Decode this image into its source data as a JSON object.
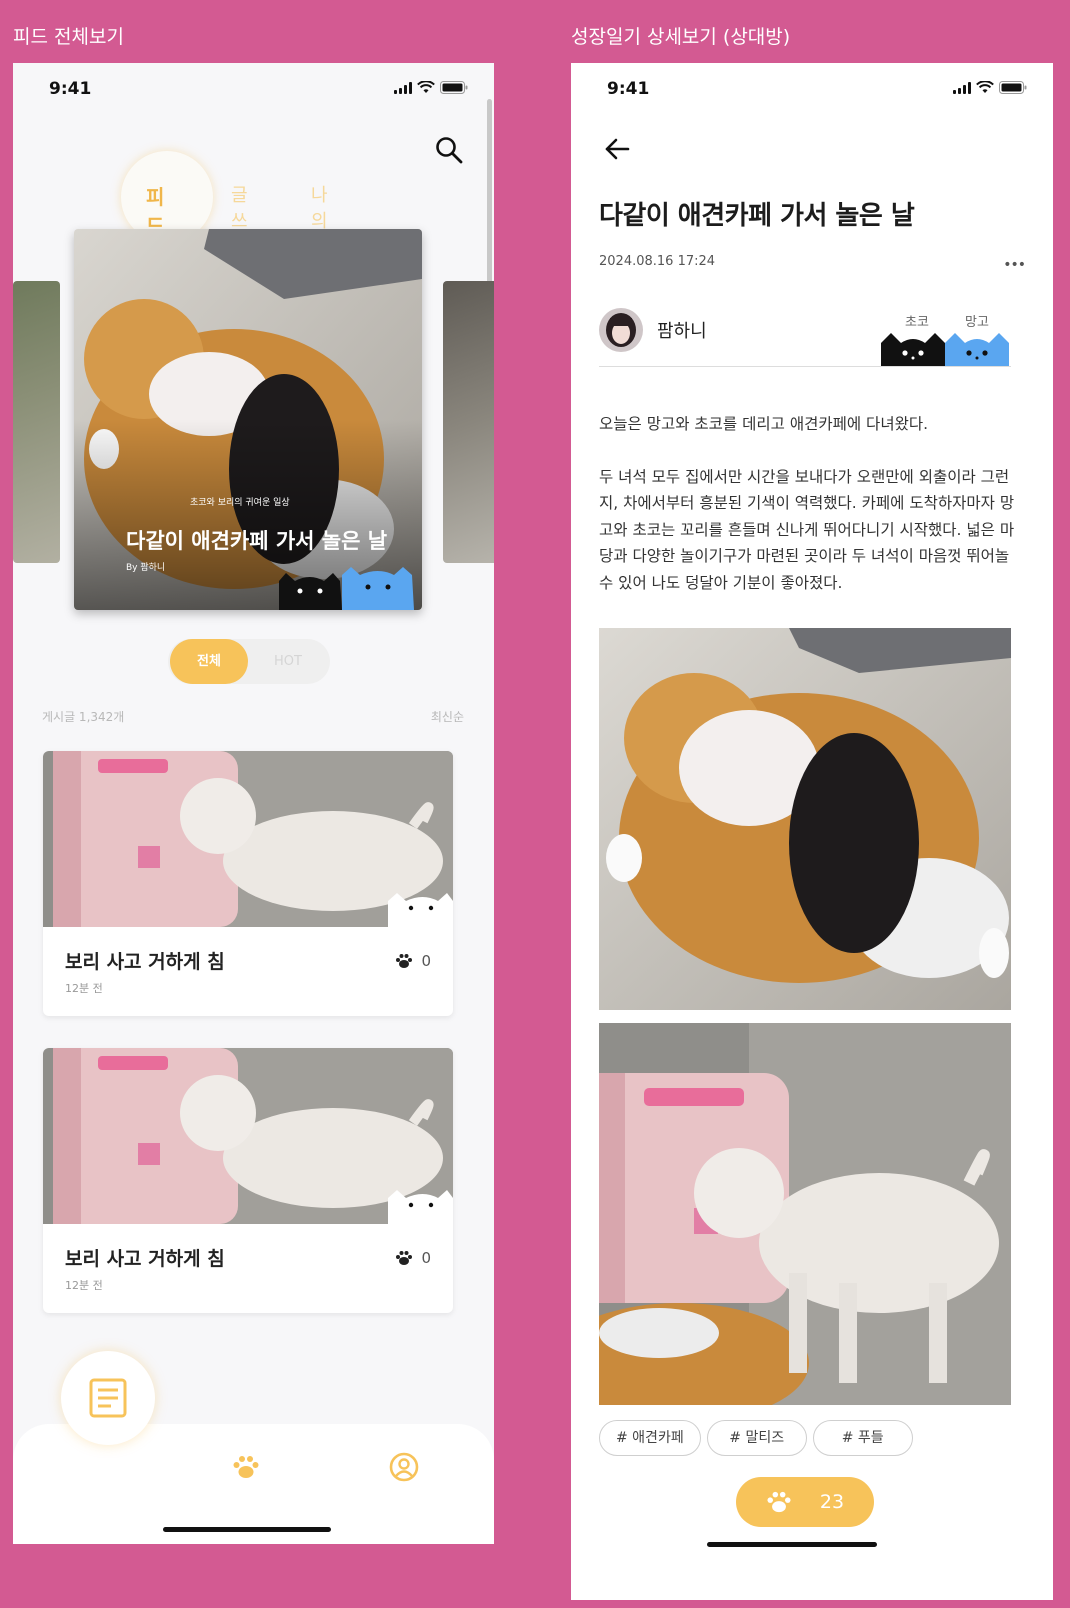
{
  "labels": {
    "left_frame": "피드 전체보기",
    "right_frame": "성장일기 상세보기 (상대방)"
  },
  "status": {
    "time": "9:41"
  },
  "feed": {
    "tabs": [
      "피드",
      "글쓰기",
      "나의 글"
    ],
    "hero": {
      "subtitle": "초코와 보리의 귀여운 일상",
      "title": "다같이 애견카페 가서 놀은 날",
      "by": "By 팜하니"
    },
    "segment": {
      "all": "전체",
      "hot": "HOT"
    },
    "post_count": "게시글 1,342개",
    "sort": "최신순",
    "posts": [
      {
        "title": "보리 사고 거하게 침",
        "time": "12분 전",
        "likes": "0"
      },
      {
        "title": "보리 사고 거하게 침",
        "time": "12분 전",
        "likes": "0"
      }
    ]
  },
  "detail": {
    "title": "다같이 애견카페 가서 놀은 날",
    "date": "2024.08.16 17:24",
    "more": "•••",
    "author": "팜하니",
    "pets": [
      "초코",
      "망고"
    ],
    "body": [
      "오늘은 망고와 초코를 데리고 애견카페에 다녀왔다.",
      "두 녀석 모두 집에서만 시간을 보내다가 오랜만에 외출이라 그런지, 차에서부터 흥분된 기색이 역력했다. 카페에 도착하자마자 망고와 초코는 꼬리를 흔들며 신나게 뛰어다니기 시작했다. 넓은 마당과 다양한 놀이기구가 마련된 곳이라 두 녀석이 마음껏 뛰어놀 수 있어 나도 덩달아 기분이 좋아졌다."
    ],
    "tags": [
      "# 애견카페",
      "# 말티즈",
      "# 푸들"
    ],
    "likes": "23"
  },
  "colors": {
    "accent": "#f7c35a",
    "background": "#d35a92",
    "cat_black": "#111111",
    "cat_blue": "#5aa6f0"
  }
}
